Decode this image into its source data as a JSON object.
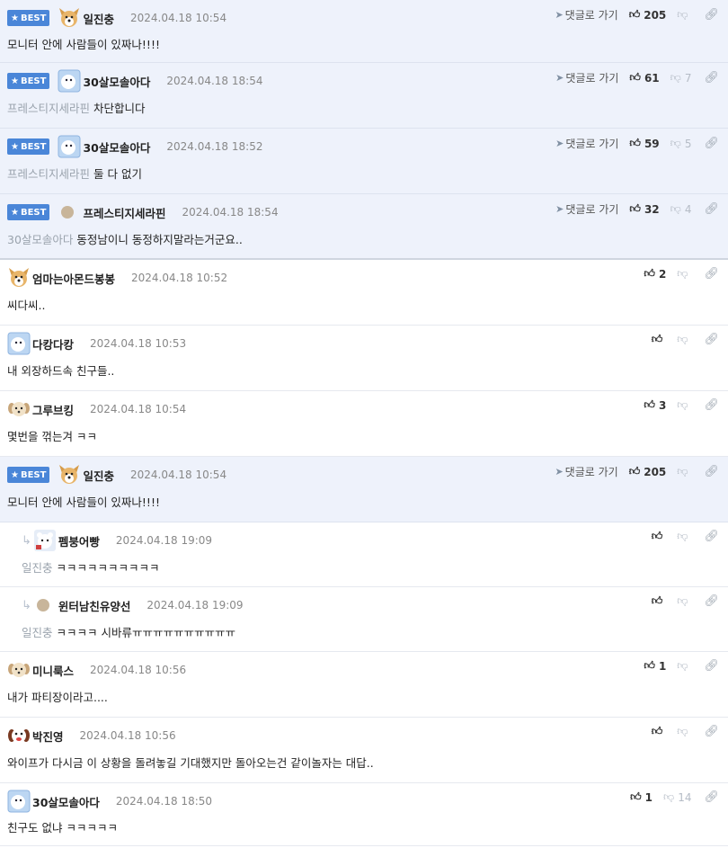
{
  "goto_label": "댓글로 가기",
  "best_label": "BEST",
  "comments": [
    {
      "best": true,
      "nick": "일진충",
      "date": "2024.04.18 10:54",
      "mention": "",
      "text": "모니터 안에 사람들이 있짜나!!!!",
      "up": "205",
      "down": "",
      "avatar": "dog"
    },
    {
      "best": true,
      "nick": "30살모솔아다",
      "date": "2024.04.18 18:54",
      "mention": "프레스티지세라핀",
      "text": "차단합니다",
      "up": "61",
      "down": "7",
      "avatar": "blue"
    },
    {
      "best": true,
      "nick": "30살모솔아다",
      "date": "2024.04.18 18:52",
      "mention": "프레스티지세라핀",
      "text": "둘 다 없기",
      "up": "59",
      "down": "5",
      "avatar": "blue"
    },
    {
      "best": true,
      "nick": "프레스티지세라핀",
      "date": "2024.04.18 18:54",
      "mention": "30살모솔아다",
      "text": "동정남이니 동정하지말라는거군요..",
      "up": "32",
      "down": "4",
      "avatar": "dot"
    },
    {
      "best": false,
      "nick": "엄마는아몬드봉봉",
      "date": "2024.04.18 10:52",
      "mention": "",
      "text": "씨다씨..",
      "up": "2",
      "down": "",
      "avatar": "dog"
    },
    {
      "best": false,
      "nick": "다캉다캉",
      "date": "2024.04.18 10:53",
      "mention": "",
      "text": "내 외장하드속 친구들..",
      "up": "",
      "down": "",
      "avatar": "blue"
    },
    {
      "best": false,
      "nick": "그루브킹",
      "date": "2024.04.18 10:54",
      "mention": "",
      "text": "몇번을 꺾는겨 ㅋㅋ",
      "up": "3",
      "down": "",
      "avatar": "pup"
    },
    {
      "best": true,
      "nick": "일진충",
      "date": "2024.04.18 10:54",
      "mention": "",
      "text": "모니터 안에 사람들이 있짜나!!!!",
      "up": "205",
      "down": "",
      "avatar": "dog"
    },
    {
      "best": false,
      "reply": true,
      "nick": "펨붕어빵",
      "date": "2024.04.18 19:09",
      "mention": "일진충",
      "text": "ㅋㅋㅋㅋㅋㅋㅋㅋㅋㅋ",
      "up": "",
      "down": "",
      "avatar": "bear"
    },
    {
      "best": false,
      "reply": true,
      "nick": "윈터남친유양선",
      "date": "2024.04.18 19:09",
      "mention": "일진충",
      "text": "ㅋㅋㅋㅋ 시바류ㅠㅠㅠㅠㅠㅠㅠㅠㅠㅠ",
      "up": "",
      "down": "",
      "avatar": "dot"
    },
    {
      "best": false,
      "nick": "미니룩스",
      "date": "2024.04.18 10:56",
      "mention": "",
      "text": "내가 파티장이라고....",
      "up": "1",
      "down": "",
      "avatar": "pup"
    },
    {
      "best": false,
      "nick": "박진영",
      "date": "2024.04.18 10:56",
      "mention": "",
      "text": "와이프가 다시금 이 상황을 돌려놓길 기대했지만 돌아오는건 같이놀자는 대답..",
      "up": "",
      "down": "",
      "avatar": "beagle"
    },
    {
      "best": false,
      "nick": "30살모솔아다",
      "date": "2024.04.18 18:50",
      "mention": "",
      "text": "친구도 없냐 ㅋㅋㅋㅋㅋ",
      "up": "1",
      "down": "14",
      "avatar": "blue"
    }
  ],
  "colors": {
    "best_badge": "#4a86d8",
    "best_bg": "#eef2fb"
  }
}
